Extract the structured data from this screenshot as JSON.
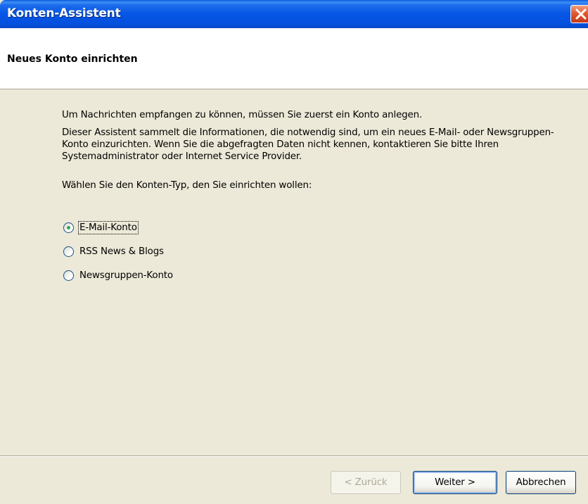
{
  "window": {
    "title": "Konten-Assistent",
    "close_icon": "close-icon"
  },
  "header": {
    "title": "Neues Konto einrichten"
  },
  "content": {
    "intro": "Um Nachrichten empfangen zu können, müssen Sie zuerst ein Konto anlegen.",
    "description": "Dieser Assistent sammelt die Informationen, die notwendig sind, um ein neues E-Mail- oder Newsgruppen-Konto einzurichten. Wenn Sie die abgefragten Daten nicht kennen, kontaktieren Sie bitte Ihren Systemadministrator oder Internet Service Provider.",
    "prompt": "Wählen Sie den Konten-Typ, den Sie einrichten wollen:",
    "account_types": [
      {
        "label": "E-Mail-Konto",
        "selected": true
      },
      {
        "label": "RSS News & Blogs",
        "selected": false
      },
      {
        "label": "Newsgruppen-Konto",
        "selected": false
      }
    ]
  },
  "buttons": {
    "back": "< Zurück",
    "next": "Weiter >",
    "cancel": "Abbrechen"
  },
  "colors": {
    "titlebar": "#0656e6",
    "dialog_bg": "#ece9d8",
    "radio_dot": "#2fa84a",
    "close": "#e05a30"
  }
}
